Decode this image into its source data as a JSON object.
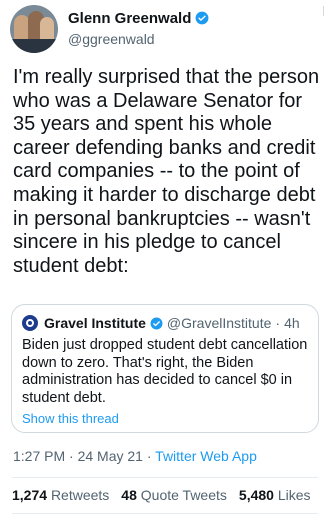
{
  "author": {
    "name": "Glenn Greenwald",
    "handle": "@ggreenwald",
    "avatar_icon": "group-photo-avatar",
    "verified_icon": "verified-badge-icon"
  },
  "tweet": {
    "text": "I'm really surprised that the person who was a Delaware Senator for 35 years and spent his whole career defending banks and credit card companies -- to the point of making it harder to discharge debt in personal bankruptcies -- wasn't sincere in his pledge to cancel student debt:"
  },
  "quoted": {
    "name": "Gravel Institute",
    "handle": "@GravelInstitute",
    "separator": "·",
    "time": "4h",
    "text": "Biden just dropped student debt cancellation down to zero. That's right, the Biden administration has decided to cancel $0 in student debt.",
    "show_thread": "Show this thread"
  },
  "meta": {
    "time": "1:27 PM",
    "sep1": " · ",
    "date": "24 May 21",
    "sep2": " · ",
    "source": "Twitter Web App"
  },
  "stats": {
    "retweets_count": "1,274",
    "retweets_label": "Retweets",
    "quotes_count": "48",
    "quotes_label": "Quote Tweets",
    "likes_count": "5,480",
    "likes_label": "Likes"
  },
  "colors": {
    "accent": "#1d9bf0",
    "secondary_text": "#536471",
    "border": "#cfd9de"
  }
}
